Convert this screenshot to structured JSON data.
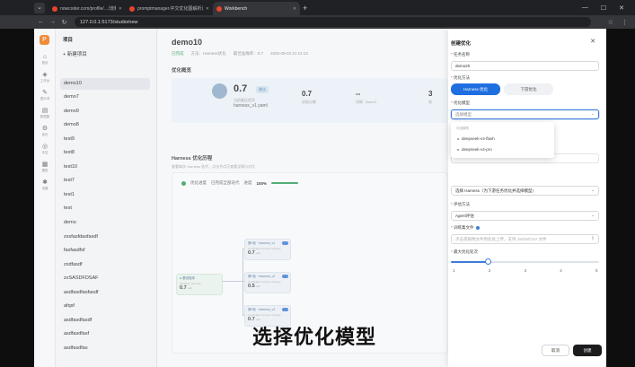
{
  "browser": {
    "menu_icon": "chevron-down-icon",
    "tabs": [
      {
        "title": "nowcoder.com/profile/…/流程实践",
        "favicon_color": "#e8452c",
        "active": false
      },
      {
        "title": "promptmanager.中文优化图解析说明",
        "favicon_color": "#e8452c",
        "active": false
      },
      {
        "title": "Workbench",
        "favicon_color": "#e8452c",
        "active": true
      }
    ],
    "new_tab": "+",
    "window_controls": [
      "—",
      "☐",
      "✕"
    ],
    "url": "127.0.0.1:5173/studio/new",
    "nav": [
      "←",
      "→",
      "↻"
    ],
    "toolbar_icons": [
      "☆",
      "⋮"
    ]
  },
  "rail": {
    "logo": "P",
    "items": [
      {
        "icon": "home-icon",
        "glyph": "⌂",
        "label": "首页"
      },
      {
        "icon": "studio-icon",
        "glyph": "◈",
        "label": "工作台"
      },
      {
        "icon": "prompt-icon",
        "glyph": "✎",
        "label": "提示词"
      },
      {
        "icon": "dataset-icon",
        "glyph": "▤",
        "label": "数据集"
      },
      {
        "icon": "optimize-icon",
        "glyph": "⚙",
        "label": "优化"
      },
      {
        "icon": "eval-icon",
        "glyph": "◎",
        "label": "评估"
      },
      {
        "icon": "model-icon",
        "glyph": "▦",
        "label": "模型"
      },
      {
        "icon": "settings-icon",
        "glyph": "✱",
        "label": "设置"
      }
    ]
  },
  "projects": {
    "title": "项目",
    "new_label": "+ 新建项目",
    "items": [
      "demo10",
      "demo7",
      "demo9",
      "demo8",
      "test9",
      "test8",
      "test10",
      "test7",
      "test1",
      "test",
      "demo",
      "zxsfasfdasfasdf",
      "fasfasdfsf",
      "zxdfasdf",
      "zxSASDFDSAF",
      "asdfasdfasfasdf",
      "afqsf",
      "asdfasdfasdf",
      "asdfasdfasf",
      "asdfasdfas"
    ],
    "selected_index": 0
  },
  "main": {
    "title": "demo10",
    "status": "已完成",
    "method": "方法：Harness优化",
    "best_metric": "最佳准确率：0.7",
    "created": "2025-09-03 21:12:13",
    "section_metrics": "优化概览",
    "best_score": "0.7",
    "best_badge": "最佳",
    "best_label": "当前最佳程序",
    "best_file": "harness_v1.yaml",
    "stats": [
      {
        "value": "0.7",
        "label": "初始分数"
      },
      {
        "value": "--",
        "label": "消耗（token）"
      },
      {
        "value": "3",
        "label": "轮"
      }
    ],
    "section_graph": "Harness 优化历程",
    "graph_desc": "查看每次 Harness 迭代，点击节点可查看详情与对比",
    "progress_label": "优化进度",
    "progress_sub": "已完成全部迭代",
    "progress_text_label": "进度",
    "progress": 100,
    "progress_text": "100%",
    "nodes": [
      {
        "head": "● 基线程序",
        "desc": "baseline_harness",
        "value": "0.7",
        "unit": "acc",
        "root": true
      },
      {
        "head": "第1轮 · harness_v1",
        "desc": "Candidate harness strategy",
        "value": "0.7",
        "unit": "acc",
        "root": false
      },
      {
        "head": "第2轮 · harness_v2",
        "desc": "Candidate harness strategy",
        "value": "0.5",
        "unit": "acc",
        "root": false
      },
      {
        "head": "第3轮 · harness_v3",
        "desc": "Candidate harness strategy",
        "value": "0.7",
        "unit": "acc",
        "root": false
      }
    ]
  },
  "drawer": {
    "title": "创建优化",
    "close_icon": "close-icon",
    "name_label": "任务名称",
    "name_value": "demo20",
    "method_label": "优化方法",
    "methods": [
      "Harness 优化",
      "下游优化"
    ],
    "method_selected": 0,
    "model_label": "优化模型",
    "model_placeholder": "选择模型",
    "model_options_group": "可选模型",
    "model_options": [
      "deepseek-v4-flash",
      "deepseek-v4-pro"
    ],
    "strategy_value": "选择 Harness（为下游任务优化并选择模型）",
    "eval_label": "评估方法",
    "eval_value": "Agent评估",
    "dataset_label": "训练集文件",
    "dataset_placeholder": "点击或拖拽文件到此处上传，支持 JSON/CSV 文件",
    "rounds_label": "最大优化轮次",
    "rounds_ticks": [
      "1",
      "2",
      "3",
      "4",
      "5"
    ],
    "rounds_value": 2,
    "rounds_max": 5,
    "cancel": "取消",
    "submit": "创建"
  },
  "caption": "选择优化模型"
}
